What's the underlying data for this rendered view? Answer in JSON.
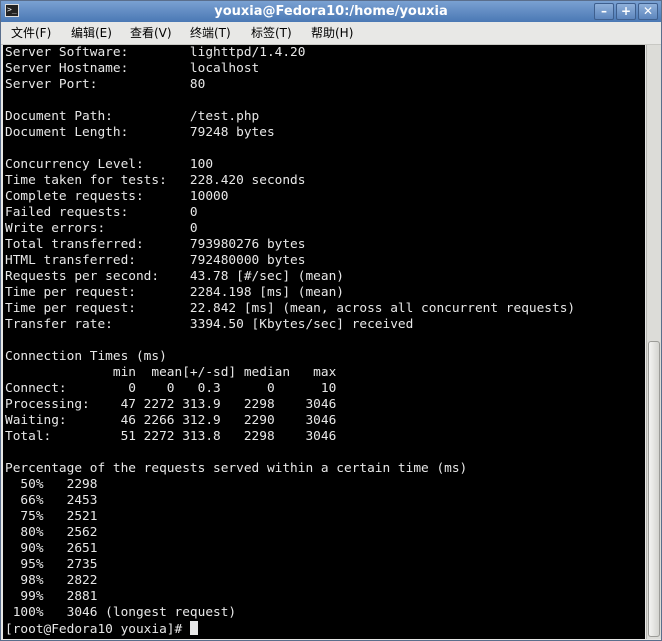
{
  "window": {
    "title": "youxia@Fedora10:/home/youxia"
  },
  "window_buttons": {
    "minimize": "–",
    "maximize": "+",
    "close": "✕"
  },
  "menu": [
    {
      "label": "文件(F)"
    },
    {
      "label": "编辑(E)"
    },
    {
      "label": "查看(V)"
    },
    {
      "label": "终端(T)"
    },
    {
      "label": "标签(T)"
    },
    {
      "label": "帮助(H)"
    }
  ],
  "terminal": {
    "lines": [
      "Server Software:        lighttpd/1.4.20",
      "Server Hostname:        localhost",
      "Server Port:            80",
      "",
      "Document Path:          /test.php",
      "Document Length:        79248 bytes",
      "",
      "Concurrency Level:      100",
      "Time taken for tests:   228.420 seconds",
      "Complete requests:      10000",
      "Failed requests:        0",
      "Write errors:           0",
      "Total transferred:      793980276 bytes",
      "HTML transferred:       792480000 bytes",
      "Requests per second:    43.78 [#/sec] (mean)",
      "Time per request:       2284.198 [ms] (mean)",
      "Time per request:       22.842 [ms] (mean, across all concurrent requests)",
      "Transfer rate:          3394.50 [Kbytes/sec] received",
      "",
      "Connection Times (ms)",
      "              min  mean[+/-sd] median   max",
      "Connect:        0    0   0.3      0      10",
      "Processing:    47 2272 313.9   2298    3046",
      "Waiting:       46 2266 312.9   2290    3046",
      "Total:         51 2272 313.8   2298    3046",
      "",
      "Percentage of the requests served within a certain time (ms)",
      "  50%   2298",
      "  66%   2453",
      "  75%   2521",
      "  80%   2562",
      "  90%   2651",
      "  95%   2735",
      "  98%   2822",
      "  99%   2881",
      " 100%   3046 (longest request)"
    ],
    "prompt": "[root@Fedora10 youxia]# "
  }
}
